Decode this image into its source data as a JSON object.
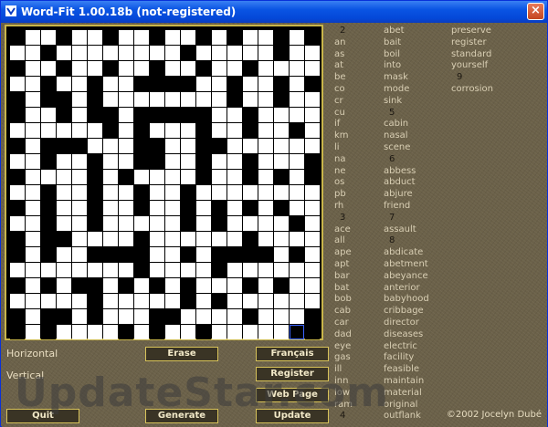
{
  "window": {
    "title": "Word-Fit 1.00.18b  (not-registered)",
    "close_label": "×",
    "accent_color": "#0a54e3"
  },
  "grid": {
    "rows": 20,
    "cols": 20,
    "selected_cell": [
      19,
      18
    ],
    "pattern": [
      "01101101101101011010",
      "11011111111011111011",
      "01101101101101101111",
      "11011011000011011010",
      "01001011111111011011",
      "01101001000001101111",
      "11111101011101101101",
      "01000111001100111111",
      "11011011001101101110",
      "01111010111101101010",
      "11011011011011111111",
      "01011011011010101011",
      "11011011111010111101",
      "01001111011111101111",
      "01011000011010000101",
      "11111111011110111111",
      "01010010101011101011",
      "11111011111010111111",
      "01001011100111101110",
      "01011110101101111110"
    ]
  },
  "labels": {
    "horizontal": "Horizontal",
    "vertical": "Vertical"
  },
  "buttons": {
    "erase": "Erase",
    "francais": "Français",
    "register": "Register",
    "webpage": "Web Page",
    "quit": "Quit",
    "generate": "Generate",
    "update": "Update"
  },
  "words": {
    "col1": [
      {
        "t": "2",
        "n": true
      },
      {
        "t": "an"
      },
      {
        "t": "as"
      },
      {
        "t": "at"
      },
      {
        "t": "be"
      },
      {
        "t": "co"
      },
      {
        "t": "cr"
      },
      {
        "t": "cu"
      },
      {
        "t": "if"
      },
      {
        "t": "km"
      },
      {
        "t": "li"
      },
      {
        "t": "na"
      },
      {
        "t": "ne"
      },
      {
        "t": "os"
      },
      {
        "t": "pb"
      },
      {
        "t": "rh"
      },
      {
        "t": "3",
        "n": true
      },
      {
        "t": "ace"
      },
      {
        "t": "all"
      },
      {
        "t": "ape"
      },
      {
        "t": "apt"
      },
      {
        "t": "bar"
      },
      {
        "t": "bat"
      },
      {
        "t": "bob"
      },
      {
        "t": "cab"
      },
      {
        "t": "car"
      },
      {
        "t": "dad"
      },
      {
        "t": "eye"
      },
      {
        "t": "gas"
      },
      {
        "t": "ill"
      },
      {
        "t": "inn"
      },
      {
        "t": "low"
      },
      {
        "t": "ram"
      },
      {
        "t": "4",
        "n": true
      }
    ],
    "col2": [
      {
        "t": "abet"
      },
      {
        "t": "bait"
      },
      {
        "t": "boil"
      },
      {
        "t": "into"
      },
      {
        "t": "mask"
      },
      {
        "t": "mode"
      },
      {
        "t": "sink"
      },
      {
        "t": "5",
        "n": true
      },
      {
        "t": "cabin"
      },
      {
        "t": "nasal"
      },
      {
        "t": "scene"
      },
      {
        "t": "6",
        "n": true
      },
      {
        "t": "abbess"
      },
      {
        "t": "abduct"
      },
      {
        "t": "abjure"
      },
      {
        "t": "friend"
      },
      {
        "t": "7",
        "n": true
      },
      {
        "t": "assault"
      },
      {
        "t": "8",
        "n": true
      },
      {
        "t": "abdicate"
      },
      {
        "t": "abetment"
      },
      {
        "t": "abeyance"
      },
      {
        "t": "anterior"
      },
      {
        "t": "babyhood"
      },
      {
        "t": "cribbage"
      },
      {
        "t": "director"
      },
      {
        "t": "diseases"
      },
      {
        "t": "electric"
      },
      {
        "t": "facility"
      },
      {
        "t": "feasible"
      },
      {
        "t": "maintain"
      },
      {
        "t": "material"
      },
      {
        "t": "original"
      },
      {
        "t": "outflank"
      }
    ],
    "col3": [
      {
        "t": "preserve"
      },
      {
        "t": "register"
      },
      {
        "t": "standard"
      },
      {
        "t": "yourself"
      },
      {
        "t": "9",
        "n": true
      },
      {
        "t": "corrosion"
      }
    ]
  },
  "copyright": "©2002 Jocelyn Dubé",
  "watermark": "UpdateStar.com"
}
